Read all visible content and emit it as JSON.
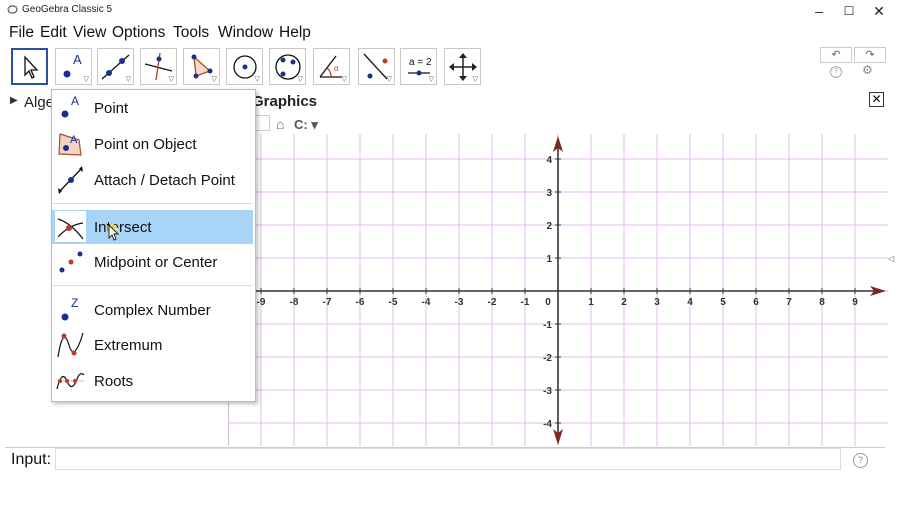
{
  "window": {
    "title": "GeoGebra Classic 5",
    "minimize": "–",
    "maximize": "☐",
    "close": "✕"
  },
  "menubar": [
    "File",
    "Edit",
    "View",
    "Options",
    "Tools",
    "Window",
    "Help"
  ],
  "toolbar": {
    "tools": [
      "move-tool",
      "point-tool",
      "line-tool",
      "perpendicular-tool",
      "polygon-tool",
      "circle-tool",
      "conic-tool",
      "angle-tool",
      "reflect-tool",
      "slider-tool",
      "move-graphics-tool"
    ],
    "slider_label": "a = 2",
    "undo": "↶",
    "redo": "↷",
    "help": "?",
    "settings": "⚙"
  },
  "algebra": {
    "title": "Alge"
  },
  "graphics": {
    "title": "Graphics",
    "close": "✕",
    "style_bar": {
      "home": "⌂",
      "coord_label": "C:"
    }
  },
  "dropdown": {
    "items": [
      {
        "label": "Point",
        "icon": "point-icon"
      },
      {
        "label": "Point on Object",
        "icon": "point-on-object-icon"
      },
      {
        "label": "Attach / Detach Point",
        "icon": "attach-detach-icon"
      },
      {
        "label": "Intersect",
        "icon": "intersect-icon",
        "selected": true
      },
      {
        "label": "Midpoint or Center",
        "icon": "midpoint-icon"
      },
      {
        "label": "Complex Number",
        "icon": "complex-number-icon"
      },
      {
        "label": "Extremum",
        "icon": "extremum-icon"
      },
      {
        "label": "Roots",
        "icon": "roots-icon"
      }
    ]
  },
  "plot": {
    "x_ticks": [
      "-9",
      "-8",
      "-7",
      "-6",
      "-5",
      "-4",
      "-3",
      "-2",
      "-1",
      "0",
      "1",
      "2",
      "3",
      "4",
      "5",
      "6",
      "7",
      "8",
      "9"
    ],
    "y_ticks": [
      "4",
      "3",
      "2",
      "1",
      "-1",
      "-2",
      "-3",
      "-4"
    ],
    "grid_color": "#e6b8f0",
    "axis_color": "#333333",
    "arrow_color": "#7a2a1a"
  },
  "input": {
    "label": "Input:",
    "value": "",
    "help": "?"
  },
  "colors": {
    "accent_selected": "#a8d4f8",
    "point": "#1a2f8a",
    "point_red": "#c0392b"
  }
}
